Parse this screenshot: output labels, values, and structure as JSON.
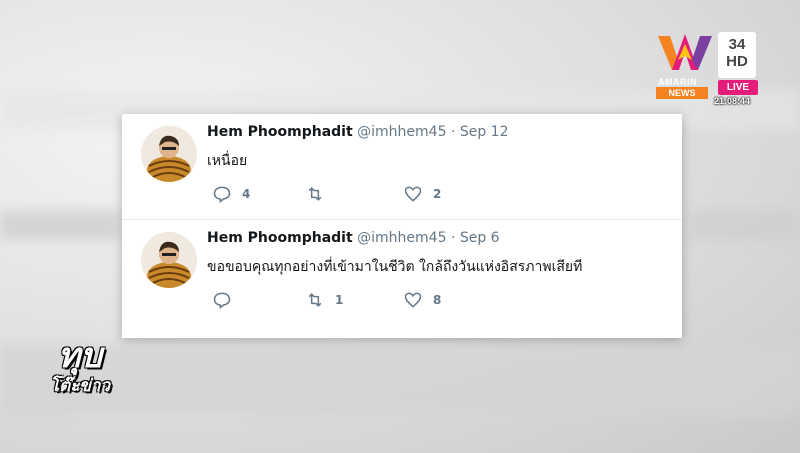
{
  "broadcast": {
    "channel_brand": "AMARIN",
    "news_label": "NEWS",
    "channel_number": "34",
    "channel_format": "HD",
    "live_label": "LIVE",
    "clock": "21:08:44",
    "show_title_top": "ทุบ",
    "show_title_bottom": "โต๊ะข่าว"
  },
  "tweets": [
    {
      "name": "Hem Phoomphadit",
      "handle": "@imhhem45",
      "separator": "·",
      "date": "Sep 12",
      "text": "เหนื่อย",
      "reply_count": "4",
      "retweet_count": "",
      "like_count": "2",
      "reply_icon": "reply-icon",
      "retweet_icon": "retweet-icon",
      "like_icon": "heart-icon"
    },
    {
      "name": "Hem Phoomphadit",
      "handle": "@imhhem45",
      "separator": "·",
      "date": "Sep 6",
      "text": "ขอขอบคุณทุกอย่างที่เข้ามาในชีวิต ใกล้ถึงวันแห่งอิสรภาพเสียที",
      "reply_count": "",
      "retweet_count": "1",
      "like_count": "8",
      "reply_icon": "reply-icon",
      "retweet_icon": "retweet-icon",
      "like_icon": "heart-icon"
    }
  ],
  "colors": {
    "text_primary": "#14171a",
    "text_secondary": "#657786",
    "news_orange": "#f58220",
    "live_pink": "#e51d7a"
  }
}
